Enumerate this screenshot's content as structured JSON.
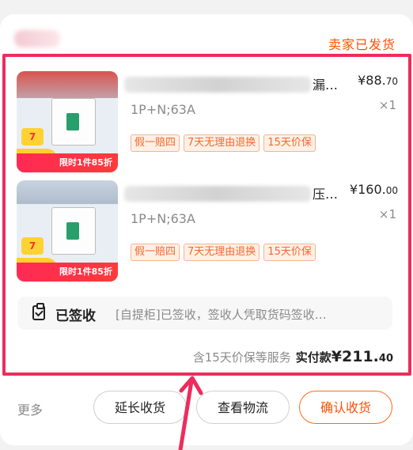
{
  "order": {
    "status": "卖家已发货",
    "items": [
      {
        "title_tail": "漏…",
        "spec": "1P+N;63A",
        "price_int": "¥88.",
        "price_dec": "70",
        "qty": "×1",
        "thumb_promo": "限时1件85折",
        "thumb_badge": "7",
        "tags": [
          "假一赔四",
          "7天无理由退换",
          "15天价保"
        ]
      },
      {
        "title_tail": "压…",
        "spec": "1P+N;63A",
        "price_int": "¥160.",
        "price_dec": "00",
        "qty": "×1",
        "thumb_promo": "限时1件85折",
        "thumb_badge": "7",
        "tags": [
          "假一赔四",
          "7天无理由退换",
          "15天价保"
        ]
      }
    ],
    "logistics": {
      "status": "已签收",
      "detail": "[自提柜]已签收，签收人凭取货码签收…"
    },
    "totals": {
      "service_note": "含15天价保等服务",
      "paid_label": "实付款",
      "amount_int": "¥211.",
      "amount_dec": "40"
    }
  },
  "actions": {
    "more": "更多",
    "extend": "延长收货",
    "track": "查看物流",
    "confirm": "确认收货"
  },
  "colors": {
    "accent": "#ff5000",
    "highlight": "#ee2c5c"
  }
}
